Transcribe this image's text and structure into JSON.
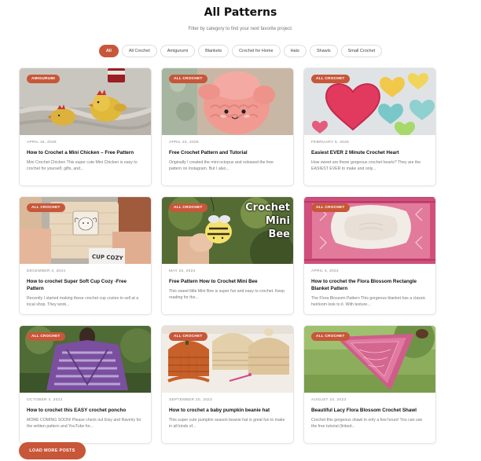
{
  "header": {
    "title": "All Patterns",
    "subtitle": "Filter by category to find your next favorite project."
  },
  "filters": [
    "All",
    "All Crochet",
    "Amigurumi",
    "Blankets",
    "Crochet for Home",
    "Hats",
    "Shawls",
    "Small Crochet"
  ],
  "active_filter": "All",
  "posts": [
    {
      "category": "AMIGURUMI",
      "date": "APRIL 15, 2025",
      "title": "How to Crochet a Mini Chicken – Free Pattern",
      "excerpt": "Mini Crochet Chicken This super cute Mini Chicken is easy to crochet for yourself, gifts, and...",
      "image_icon": "chicken-photo"
    },
    {
      "category": "ALL CROCHET",
      "date": "APRIL 22, 2025",
      "title": "Free Crochet Pattern and Tutorial",
      "excerpt": "Originally I created the mini octopus and released the free pattern on Instagram. But I also...",
      "image_icon": "octopus-photo"
    },
    {
      "category": "ALL CROCHET",
      "date": "FEBRUARY 6, 2025",
      "title": "Easiest EVER 2 Minute Crochet Heart",
      "excerpt": "How sweet are these gorgeous crochet hearts? They are the EASIEST EVER to make and only...",
      "image_icon": "hearts-photo"
    },
    {
      "category": "ALL CROCHET",
      "date": "DECEMBER 4, 2024",
      "title": "How to crochet Super Soft Cup Cozy -Free Pattern",
      "excerpt": "Recently I started making these crochet cup cozies to sell at a local shop. They work...",
      "image_icon": "cup-cozy-photo",
      "image_text": "CUP COZY"
    },
    {
      "category": "ALL CROCHET",
      "date": "MAY 22, 2024",
      "title": "Free Pattern How to Crochet Mini Bee",
      "excerpt": "This sweet little Mini Bee is super fun and easy to crochet. Keep reading for the...",
      "image_icon": "bee-photo",
      "image_text": [
        "Crochet",
        "Mini",
        "Bee"
      ]
    },
    {
      "category": "ALL CROCHET",
      "date": "APRIL 3, 2024",
      "title": "How to crochet the Flora Blossom Rectangle Blanket Pattern",
      "excerpt": "The Flora Blossom Pattern This gorgeous blanket has a classic heirloom look to it. With texture...",
      "image_icon": "blanket-photo"
    },
    {
      "category": "ALL CROCHET",
      "date": "OCTOBER 4, 2023",
      "title": "How to crochet this EASY crochet poncho",
      "excerpt": "MORE COMING SOON! Please check out Etsy and Ravelry for the written pattern and YouTube for...",
      "image_icon": "poncho-photo"
    },
    {
      "category": "ALL CROCHET",
      "date": "SEPTEMBER 20, 2023",
      "title": "How to crochet a baby pumpkin beanie hat",
      "excerpt": "This super cute pumpkin season beanie hat is great fun to make in all kinds of...",
      "image_icon": "beanie-photo"
    },
    {
      "category": "ALL CROCHET",
      "date": "AUGUST 23, 2023",
      "title": "Beautiful Lacy Flora Blossom Crochet Shawl",
      "excerpt": "Crochet this gorgeous shawl in only a few hours! You can use the free tutorial (linked...",
      "image_icon": "shawl-photo"
    }
  ],
  "load_more_label": "LOAD MORE POSTS",
  "colors": {
    "accent": "#c8573a",
    "text": "#111111",
    "muted": "#777777"
  }
}
